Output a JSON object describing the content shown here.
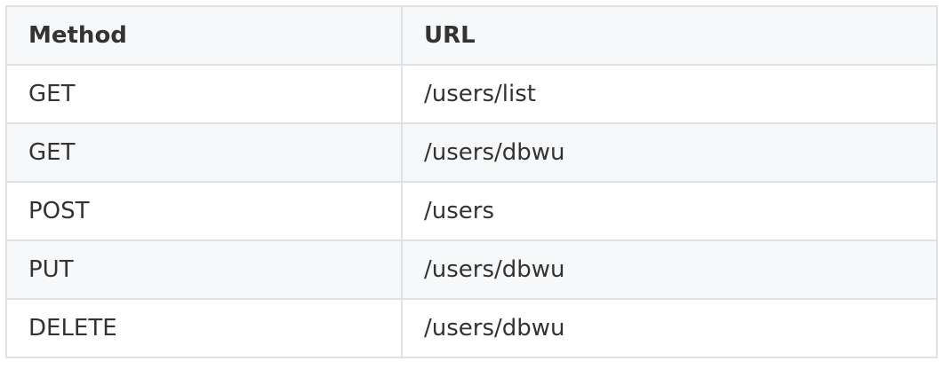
{
  "table": {
    "headers": [
      "Method",
      "URL"
    ],
    "rows": [
      {
        "method": "GET",
        "url": "/users/list"
      },
      {
        "method": "GET",
        "url": "/users/dbwu"
      },
      {
        "method": "POST",
        "url": "/users"
      },
      {
        "method": "PUT",
        "url": "/users/dbwu"
      },
      {
        "method": "DELETE",
        "url": "/users/dbwu"
      }
    ]
  }
}
